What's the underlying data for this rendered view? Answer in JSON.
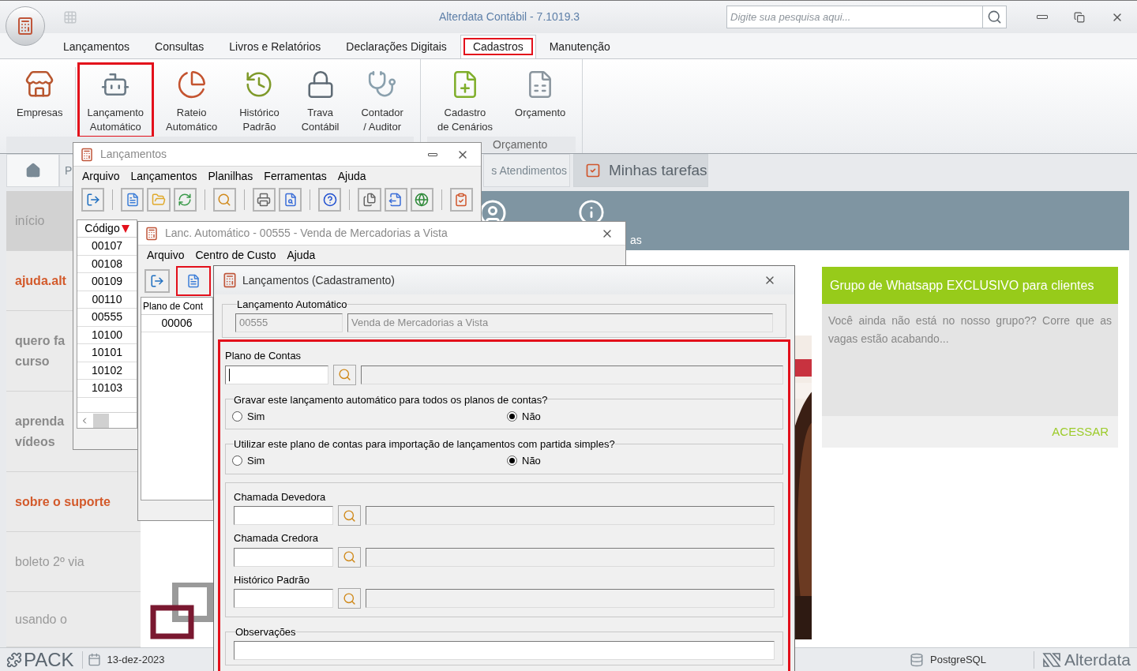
{
  "window": {
    "title": "Alterdata Contábil - 7.1019.3",
    "search": {
      "placeholder": "Digite sua pesquisa aqui..."
    }
  },
  "menu_tabs": [
    {
      "label": "Lançamentos",
      "selected": false,
      "highlighted": false
    },
    {
      "label": "Consultas",
      "selected": false,
      "highlighted": false
    },
    {
      "label": "Livros e Relatórios",
      "selected": false,
      "highlighted": false
    },
    {
      "label": "Declarações Digitais",
      "selected": false,
      "highlighted": false
    },
    {
      "label": "Cadastros",
      "selected": true,
      "highlighted": true
    },
    {
      "label": "Manutenção",
      "selected": false,
      "highlighted": false
    }
  ],
  "ribbon": {
    "groups": [
      {
        "items": [
          {
            "kind": "company",
            "lines": [
              "Empresas"
            ],
            "highlighted": false
          },
          {
            "kind": "robot",
            "lines": [
              "Lançamento",
              "Automático"
            ],
            "highlighted": true
          },
          {
            "kind": "pie",
            "lines": [
              "Rateio",
              "Automático"
            ],
            "highlighted": false
          },
          {
            "kind": "clock",
            "lines": [
              "Histórico",
              "Padrão"
            ],
            "highlighted": false
          },
          {
            "kind": "lock",
            "lines": [
              "Trava",
              "Contábil"
            ],
            "highlighted": false
          },
          {
            "kind": "caduceus",
            "lines": [
              "Contador",
              "/ Auditor"
            ],
            "highlighted": false
          }
        ]
      },
      {
        "label": "Orçamento",
        "items": [
          {
            "kind": "scenario",
            "lines": [
              "Cadastro",
              "de Cenários"
            ],
            "highlighted": false
          },
          {
            "kind": "budget",
            "lines": [
              "Orçamento"
            ],
            "highlighted": false
          }
        ]
      }
    ]
  },
  "home_tabs": [
    {
      "kind": "home",
      "selected": false
    },
    {
      "kind": "text",
      "label": "P",
      "selected": false
    },
    {
      "kind": "text",
      "label": "s Atendimentos",
      "selected": false
    },
    {
      "kind": "tasks",
      "label": "Minhas tarefas",
      "selected": true
    }
  ],
  "sidebar": [
    {
      "kind": "plain",
      "lines": [
        "início"
      ],
      "selected": true
    },
    {
      "kind": "accent",
      "lines": [
        "ajuda.alt"
      ],
      "selected": false
    },
    {
      "kind": "bold",
      "lines": [
        "quero fa",
        "curso"
      ],
      "selected": false
    },
    {
      "kind": "bold",
      "lines": [
        "aprenda",
        "vídeos"
      ],
      "selected": false
    },
    {
      "kind": "accent",
      "lines": [
        "sobre o suporte"
      ],
      "selected": false
    },
    {
      "kind": "plain",
      "lines": [
        "boleto 2º via"
      ],
      "selected": false
    },
    {
      "kind": "plain",
      "lines": [
        "usando o"
      ],
      "selected": false
    }
  ],
  "banner": {
    "caption": "as"
  },
  "card": {
    "title": "Grupo de Whatsapp EXCLUSIVO para clientes",
    "body": "Você ainda não está no nosso grupo?? Corre que as vagas estão acabando...",
    "link": "ACESSAR"
  },
  "lancamentos_window": {
    "title": "Lançamentos",
    "menu": [
      "Arquivo",
      "Lançamentos",
      "Planilhas",
      "Ferramentas",
      "Ajuda"
    ],
    "list": {
      "column": "Código",
      "sorted": true,
      "rows": [
        "00107",
        "00108",
        "00109",
        "00110",
        "00555",
        "10100",
        "10101",
        "10102",
        "10103"
      ]
    }
  },
  "auto_window": {
    "title": "Lanc. Automático - 00555 - Venda de Mercadorias a Vista",
    "menu": [
      "Arquivo",
      "Centro de Custo",
      "Ajuda"
    ],
    "toolbar": [
      {
        "kind": "exit",
        "highlighted": false
      },
      {
        "kind": "new",
        "highlighted": true
      }
    ],
    "grid": {
      "column": "Plano de Cont",
      "rows": [
        "00006"
      ]
    }
  },
  "dialog": {
    "title": "Lançamentos (Cadastramento)",
    "highlighted": true,
    "auto_group": {
      "legend": "Lançamento Automático",
      "code": "00555",
      "description": "Venda de Mercadorias a Vista",
      "disabled": true
    },
    "plano": {
      "label": "Plano de Contas",
      "focused": true
    },
    "questions": [
      {
        "legend": "Gravar este lançamento automático para todos os planos de contas?",
        "options": [
          {
            "label": "Sim",
            "selected": false
          },
          {
            "label": "Não",
            "selected": true
          }
        ]
      },
      {
        "legend": "Utilizar este plano de contas para importação de lançamentos com partida simples?",
        "options": [
          {
            "label": "Sim",
            "selected": false
          },
          {
            "label": "Não",
            "selected": true
          }
        ]
      }
    ],
    "lookups": [
      {
        "label": "Chamada Devedora"
      },
      {
        "label": "Chamada Credora"
      },
      {
        "label": "Histórico Padrão"
      }
    ],
    "notes": {
      "legend": "Observações"
    }
  },
  "status_bar": {
    "product": "PACK",
    "date": "13-dez-2023",
    "database": "PostgreSQL",
    "brand": "Alterdata"
  }
}
